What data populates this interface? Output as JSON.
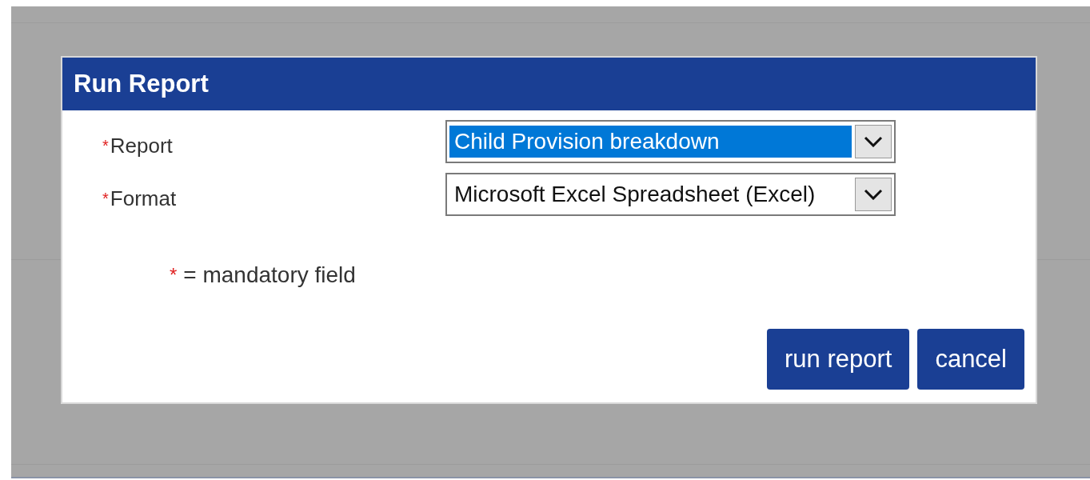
{
  "dialog": {
    "title": "Run Report",
    "fields": [
      {
        "label": "Report",
        "required_mark": "*",
        "value": "Child Provision breakdown",
        "selected": true
      },
      {
        "label": "Format",
        "required_mark": "*",
        "value": "Microsoft Excel Spreadsheet (Excel)",
        "selected": false
      }
    ],
    "legend": {
      "mark": "*",
      "text": "= mandatory field"
    },
    "buttons": [
      "run report",
      "cancel"
    ]
  }
}
